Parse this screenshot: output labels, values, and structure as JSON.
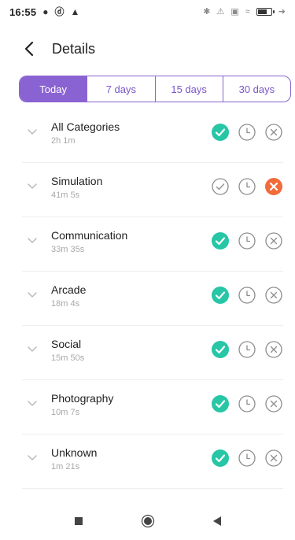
{
  "status_bar": {
    "time": "16:55",
    "left_icons": [
      "person-icon",
      "p-icon",
      "warning-icon"
    ],
    "right_icons": [
      "bluetooth-icon",
      "mute-icon",
      "sim-icon",
      "wifi-icon",
      "battery-icon",
      "charging-icon"
    ]
  },
  "header": {
    "title": "Details",
    "back_icon": "chevron-left-icon"
  },
  "tabs": [
    {
      "label": "Today",
      "active": true
    },
    {
      "label": "7 days",
      "active": false
    },
    {
      "label": "15 days",
      "active": false
    },
    {
      "label": "30 days",
      "active": false
    }
  ],
  "categories": [
    {
      "name": "All Categories",
      "time": "2h 1m",
      "state": "allowed"
    },
    {
      "name": "Simulation",
      "time": "41m 5s",
      "state": "blocked"
    },
    {
      "name": "Communication",
      "time": "33m 35s",
      "state": "allowed"
    },
    {
      "name": "Arcade",
      "time": "18m 4s",
      "state": "allowed"
    },
    {
      "name": "Social",
      "time": "15m 50s",
      "state": "allowed"
    },
    {
      "name": "Photography",
      "time": "10m 7s",
      "state": "allowed"
    },
    {
      "name": "Unknown",
      "time": "1m 21s",
      "state": "allowed"
    }
  ],
  "colors": {
    "accent": "#8a63d2",
    "allow": "#26c6a6",
    "block": "#f26b3a",
    "icon_outline": "#8d8d8d"
  },
  "nav_bar": [
    "recent-apps-button",
    "home-button",
    "back-nav-button"
  ]
}
